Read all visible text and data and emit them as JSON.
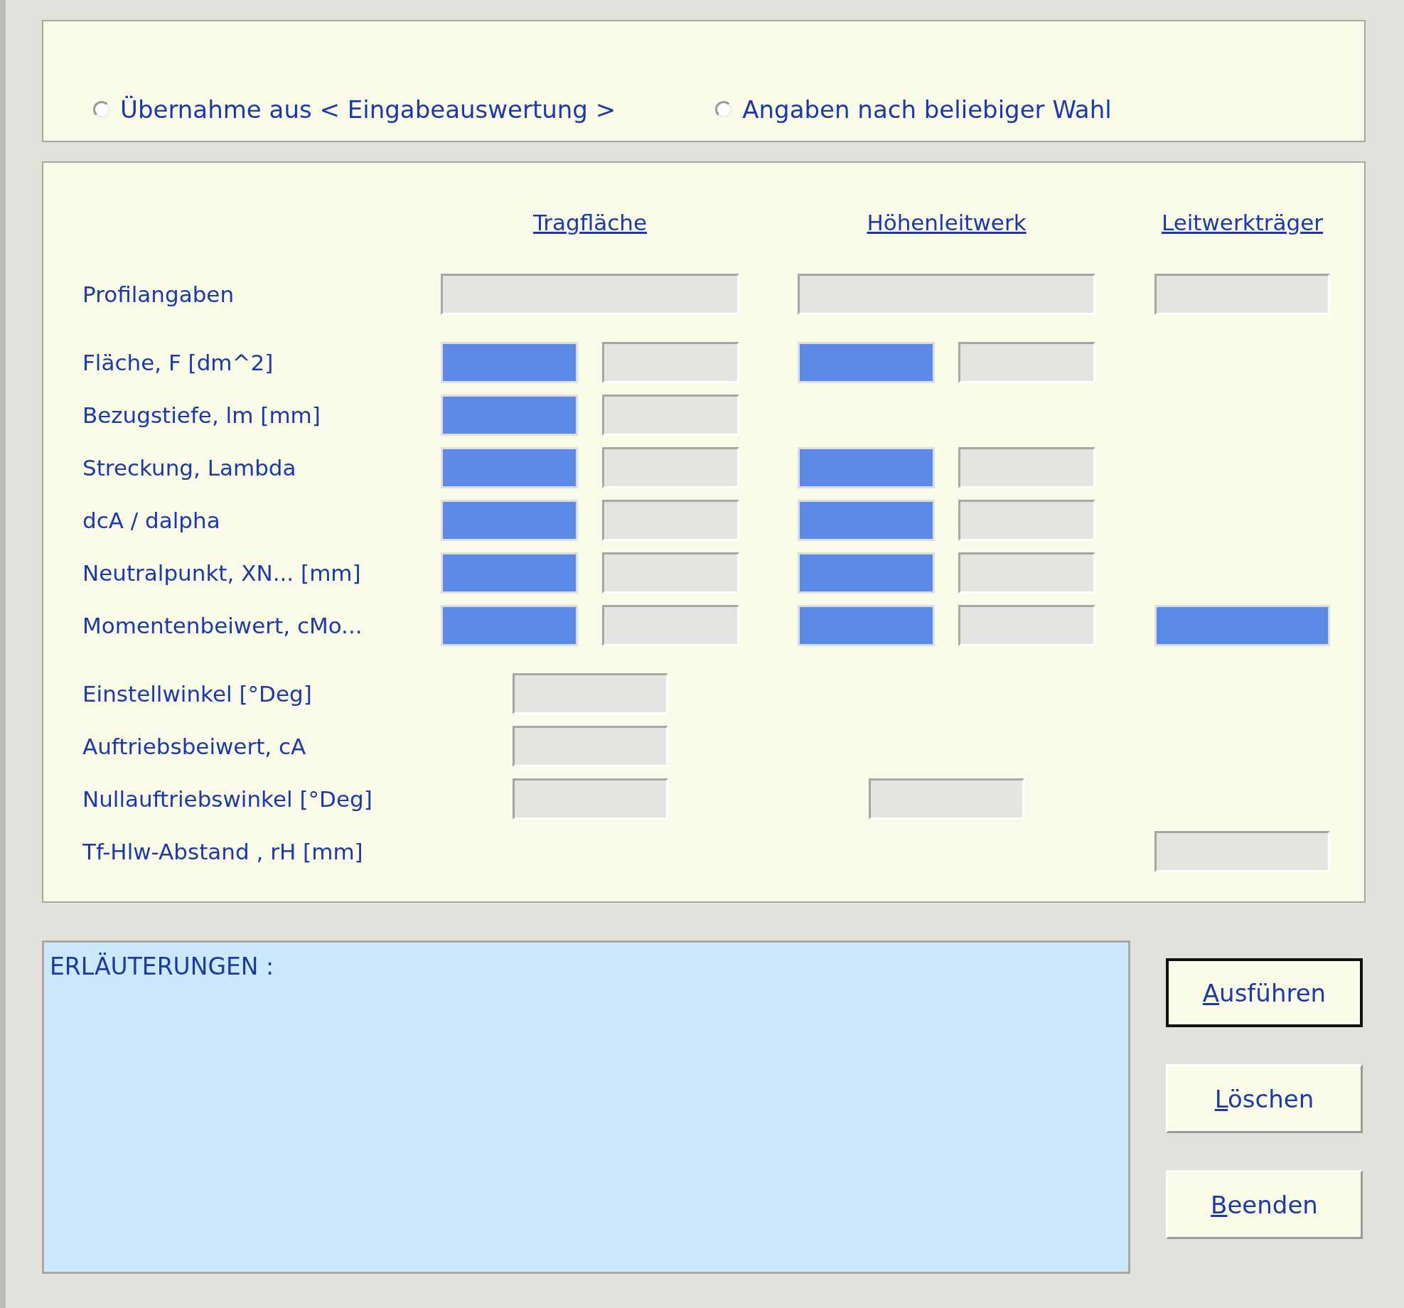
{
  "source_options": [
    {
      "label": "Übernahme aus  < Eingabeauswertung >",
      "selected": false
    },
    {
      "label": "Angaben nach beliebiger Wahl",
      "selected": false
    }
  ],
  "columns": [
    "Tragfläche",
    "Höhenleitwerk",
    "Leitwerkträger"
  ],
  "rows": [
    {
      "label": "Profilangaben",
      "kind": "profile",
      "tragflaeche": [
        {
          "highlighted": false
        }
      ],
      "hoehenleitwerk": [
        {
          "highlighted": false
        }
      ],
      "leitwerktraeger": [
        {
          "highlighted": false
        }
      ]
    },
    {
      "label": "Fläche, F [dm^2]",
      "kind": "pair",
      "tragflaeche": [
        {
          "highlighted": true
        },
        {
          "highlighted": false
        }
      ],
      "hoehenleitwerk": [
        {
          "highlighted": true
        },
        {
          "highlighted": false
        }
      ]
    },
    {
      "label": "Bezugstiefe, lm [mm]",
      "kind": "pair",
      "tragflaeche": [
        {
          "highlighted": true
        },
        {
          "highlighted": false
        }
      ]
    },
    {
      "label": "Streckung, Lambda",
      "kind": "pair",
      "tragflaeche": [
        {
          "highlighted": true
        },
        {
          "highlighted": false
        }
      ],
      "hoehenleitwerk": [
        {
          "highlighted": true
        },
        {
          "highlighted": false
        }
      ]
    },
    {
      "label": "dcA / dalpha",
      "kind": "pair",
      "tragflaeche": [
        {
          "highlighted": true
        },
        {
          "highlighted": false
        }
      ],
      "hoehenleitwerk": [
        {
          "highlighted": true
        },
        {
          "highlighted": false
        }
      ]
    },
    {
      "label": "Neutralpunkt, XN... [mm]",
      "kind": "pair",
      "tragflaeche": [
        {
          "highlighted": true
        },
        {
          "highlighted": false
        }
      ],
      "hoehenleitwerk": [
        {
          "highlighted": true
        },
        {
          "highlighted": false
        }
      ]
    },
    {
      "label": "Momentenbeiwert, cMo...",
      "kind": "pair",
      "tragflaeche": [
        {
          "highlighted": true
        },
        {
          "highlighted": false
        }
      ],
      "hoehenleitwerk": [
        {
          "highlighted": true
        },
        {
          "highlighted": false
        }
      ],
      "leitwerktraeger": [
        {
          "highlighted": true
        }
      ]
    },
    {
      "label": "Einstellwinkel  [°Deg]",
      "kind": "single",
      "tragflaeche": [
        {
          "highlighted": false
        }
      ]
    },
    {
      "label": "Auftriebsbeiwert, cA",
      "kind": "single",
      "tragflaeche": [
        {
          "highlighted": false
        }
      ]
    },
    {
      "label": "Nullauftriebswinkel [°Deg]",
      "kind": "single",
      "tragflaeche": [
        {
          "highlighted": false
        }
      ],
      "hoehenleitwerk": [
        {
          "highlighted": false
        }
      ]
    },
    {
      "label": "Tf-Hlw-Abstand , rH [mm]",
      "kind": "single",
      "leitwerktraeger": [
        {
          "highlighted": false
        }
      ]
    }
  ],
  "notes": {
    "title": "ERLÄUTERUNGEN :"
  },
  "buttons": [
    {
      "access_key": "A",
      "rest": "usführen",
      "default": true
    },
    {
      "access_key": "L",
      "rest": "öschen",
      "default": false
    },
    {
      "access_key": "B",
      "rest": "eenden",
      "default": false
    }
  ]
}
